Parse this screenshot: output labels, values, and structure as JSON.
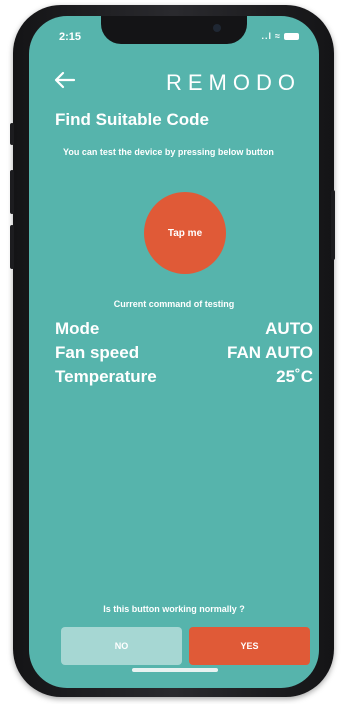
{
  "status_bar": {
    "time": "2:15",
    "signal": "..l",
    "wifi": "≈"
  },
  "header": {
    "brand": "REMODO"
  },
  "main": {
    "title": "Find Suitable Code",
    "subtitle": "You can test the device by pressing below button",
    "tap_label": "Tap me",
    "current_command_label": "Current command of testing",
    "params": [
      {
        "label": "Mode",
        "value": "AUTO"
      },
      {
        "label": "Fan speed",
        "value": "FAN AUTO"
      },
      {
        "label": "Temperature",
        "value": "25˚C"
      }
    ]
  },
  "footer": {
    "question": "Is this button working normally ?",
    "no_label": "NO",
    "yes_label": "YES"
  },
  "colors": {
    "screen_bg": "#56b4ac",
    "accent": "#e05a37",
    "no_button": "#a6d7d3"
  },
  "icons": {
    "back": "arrow-left-icon"
  }
}
